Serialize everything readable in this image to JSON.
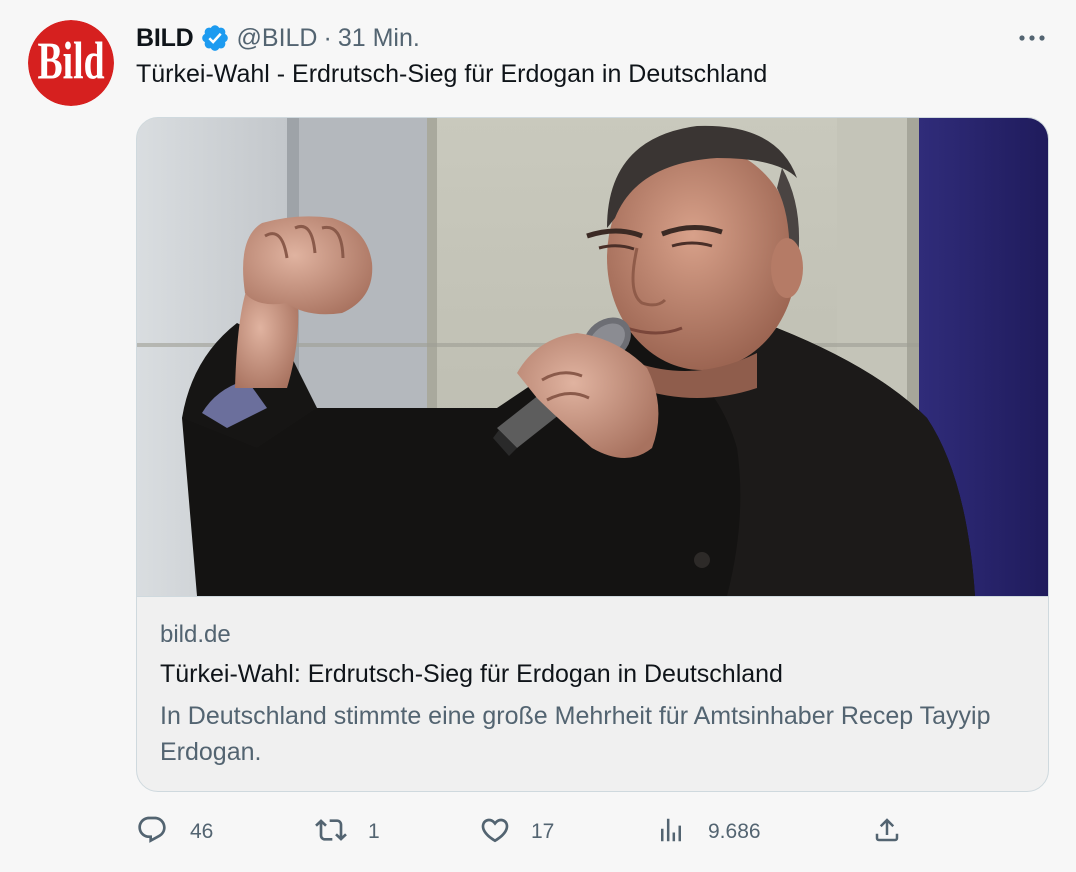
{
  "author": {
    "display_name": "BILD",
    "handle": "@BILD",
    "separator": "·",
    "time": "31 Min.",
    "avatar_text": "Bild",
    "verified": true
  },
  "tweet": {
    "text": "Türkei-Wahl - Erdrutsch-Sieg für Erdogan in Deutschland"
  },
  "card": {
    "domain": "bild.de",
    "title": "Türkei-Wahl: Erdrutsch-Sieg für Erdogan in Deutschland",
    "description": "In Deutschland stimmte eine große Mehrheit für Amtsinhaber Recep Tayyip Erdogan."
  },
  "actions": {
    "replies": "46",
    "retweets": "1",
    "likes": "17",
    "views": "9.686"
  },
  "icons": {
    "verified": "verified-badge-icon",
    "more": "more-options-icon",
    "reply": "reply-icon",
    "retweet": "retweet-icon",
    "like": "heart-icon",
    "views": "views-chart-icon",
    "share": "share-icon"
  },
  "colors": {
    "brand_red": "#d6201f",
    "verified_blue": "#1d9bf0",
    "secondary_text": "#536471",
    "primary_text": "#0f1419"
  }
}
